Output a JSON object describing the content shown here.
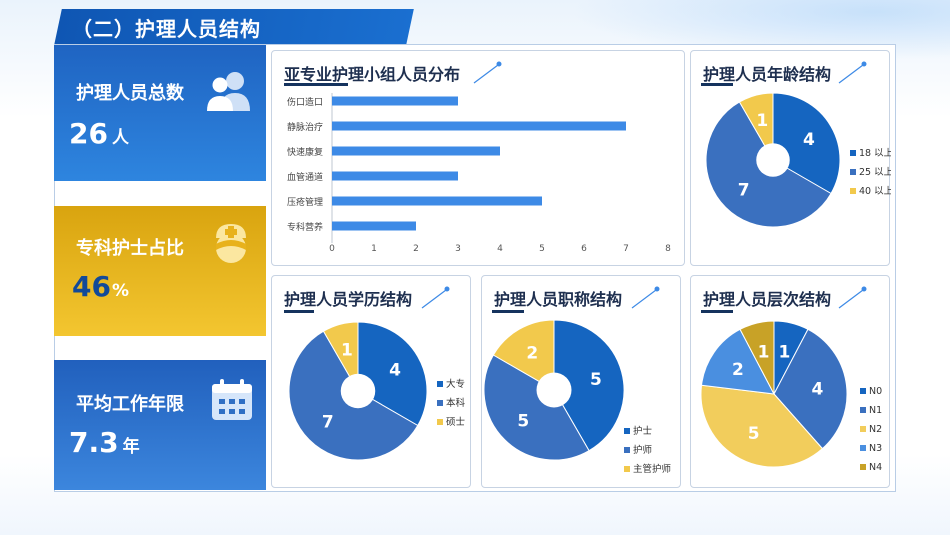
{
  "header": {
    "title": "（二）护理人员结构"
  },
  "kpis": {
    "total": {
      "label": "护理人员总数",
      "value": "26",
      "unit": "人"
    },
    "specialist": {
      "label": "专科护士占比",
      "value": "46",
      "unit": "%"
    },
    "years": {
      "label": "平均工作年限",
      "value": "7.3",
      "unit": "年"
    }
  },
  "panels": {
    "groups": {
      "title": "亚专业护理小组人员分布"
    },
    "age": {
      "title": "护理人员年龄结构"
    },
    "edu": {
      "title": "护理人员学历结构"
    },
    "rank": {
      "title": "护理人员职称结构"
    },
    "level": {
      "title": "护理人员层次结构"
    }
  },
  "colors": {
    "accent": "#1565c0",
    "gold": "#f2c230",
    "bar": "#3d8ae6"
  },
  "chart_data": [
    {
      "id": "groups",
      "type": "bar",
      "orientation": "horizontal",
      "categories": [
        "伤口造口",
        "静脉治疗",
        "快速康复",
        "血管通道",
        "压疮管理",
        "专科营养"
      ],
      "values": [
        3,
        7,
        4,
        3,
        5,
        2
      ],
      "xlim": [
        0,
        8
      ],
      "xticks": [
        "0",
        "1",
        "2",
        "3",
        "4",
        "5",
        "6",
        "7",
        "8"
      ]
    },
    {
      "id": "age",
      "type": "pie",
      "donut": true,
      "labels": [
        "18 以上",
        "25 以上",
        "40 以上"
      ],
      "values": [
        4,
        7,
        1
      ],
      "colors": [
        "#1565c0",
        "#3a70bf",
        "#f2c94c"
      ]
    },
    {
      "id": "edu",
      "type": "pie",
      "donut": true,
      "labels": [
        "大专",
        "本科",
        "硕士"
      ],
      "values": [
        4,
        7,
        1
      ],
      "colors": [
        "#1565c0",
        "#3a70bf",
        "#f2c94c"
      ]
    },
    {
      "id": "rank",
      "type": "pie",
      "donut": true,
      "labels": [
        "护士",
        "护师",
        "主管护师"
      ],
      "values": [
        5,
        5,
        2
      ],
      "colors": [
        "#1565c0",
        "#3a70bf",
        "#f2c94c"
      ]
    },
    {
      "id": "level",
      "type": "pie",
      "donut": false,
      "labels": [
        "N0",
        "N1",
        "N2",
        "N3",
        "N4"
      ],
      "values": [
        1,
        4,
        5,
        2,
        1
      ],
      "colors": [
        "#1565c0",
        "#3a70bf",
        "#f2cd5c",
        "#4a8fe0",
        "#c8a227"
      ]
    }
  ]
}
